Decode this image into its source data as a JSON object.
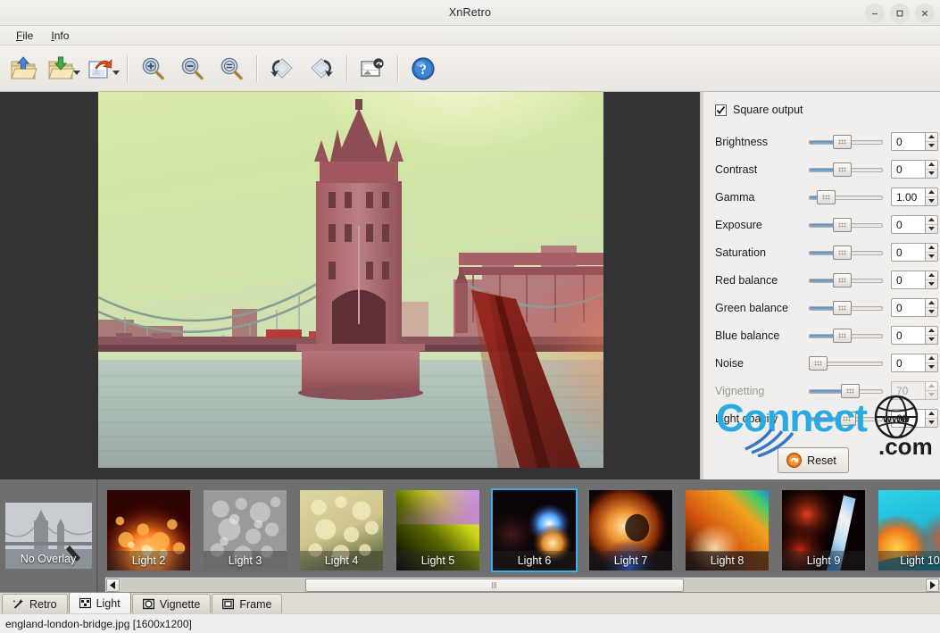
{
  "window": {
    "title": "XnRetro",
    "minimize_label": "Minimize",
    "maximize_label": "Maximize",
    "close_label": "Close"
  },
  "menu": {
    "items": [
      {
        "label": "File",
        "mnemonic": "F"
      },
      {
        "label": "Info",
        "mnemonic": "I"
      }
    ]
  },
  "toolbar": {
    "buttons": [
      {
        "name": "open-image-button",
        "tooltip": "Open image"
      },
      {
        "name": "save-image-button",
        "tooltip": "Save image"
      },
      {
        "name": "share-image-button",
        "tooltip": "Share image"
      },
      {
        "name": "zoom-in-button",
        "tooltip": "Zoom in"
      },
      {
        "name": "zoom-out-button",
        "tooltip": "Zoom out"
      },
      {
        "name": "zoom-fit-button",
        "tooltip": "Fit to window"
      },
      {
        "name": "rotate-left-button",
        "tooltip": "Rotate left"
      },
      {
        "name": "rotate-right-button",
        "tooltip": "Rotate right"
      },
      {
        "name": "reload-image-button",
        "tooltip": "Reload image"
      },
      {
        "name": "help-button",
        "tooltip": "Help"
      }
    ]
  },
  "panel": {
    "square_output": {
      "label": "Square output",
      "checked": true
    },
    "sliders": [
      {
        "label": "Brightness",
        "value": "0",
        "fill_pct": 43,
        "thumb_pct": 43,
        "enabled": true
      },
      {
        "label": "Contrast",
        "value": "0",
        "fill_pct": 43,
        "thumb_pct": 43,
        "enabled": true
      },
      {
        "label": "Gamma",
        "value": "1.00",
        "fill_pct": 14,
        "thumb_pct": 14,
        "enabled": true
      },
      {
        "label": "Exposure",
        "value": "0",
        "fill_pct": 43,
        "thumb_pct": 43,
        "enabled": true
      },
      {
        "label": "Saturation",
        "value": "0",
        "fill_pct": 43,
        "thumb_pct": 43,
        "enabled": true
      },
      {
        "label": "Red balance",
        "value": "0",
        "fill_pct": 43,
        "thumb_pct": 43,
        "enabled": true
      },
      {
        "label": "Green balance",
        "value": "0",
        "fill_pct": 43,
        "thumb_pct": 43,
        "enabled": true
      },
      {
        "label": "Blue balance",
        "value": "0",
        "fill_pct": 43,
        "thumb_pct": 43,
        "enabled": true
      },
      {
        "label": "Noise",
        "value": "0",
        "fill_pct": 0,
        "thumb_pct": 0,
        "enabled": true
      },
      {
        "label": "Vignetting",
        "value": "70",
        "fill_pct": 58,
        "thumb_pct": 58,
        "enabled": false
      },
      {
        "label": "Light opacity",
        "value": "60",
        "fill_pct": 52,
        "thumb_pct": 52,
        "enabled": true
      }
    ],
    "reset": {
      "label": "Reset"
    }
  },
  "watermark": {
    "word": "Connect",
    "globe_text": "www",
    "tld": ".com",
    "color": "#29ABE2"
  },
  "overlays": {
    "no_overlay_label": "No Overlay",
    "items": [
      {
        "label": "Light 2",
        "selected": false
      },
      {
        "label": "Light 3",
        "selected": false
      },
      {
        "label": "Light 4",
        "selected": false
      },
      {
        "label": "Light 5",
        "selected": false
      },
      {
        "label": "Light 6",
        "selected": true
      },
      {
        "label": "Light 7",
        "selected": false
      },
      {
        "label": "Light 8",
        "selected": false
      },
      {
        "label": "Light 9",
        "selected": false
      },
      {
        "label": "Light 10",
        "selected": false
      }
    ]
  },
  "tabs": [
    {
      "label": "Retro",
      "icon": "wand-icon",
      "active": false
    },
    {
      "label": "Light",
      "icon": "grid-icon",
      "active": true
    },
    {
      "label": "Vignette",
      "icon": "circle-icon",
      "active": false
    },
    {
      "label": "Frame",
      "icon": "square-icon",
      "active": false
    }
  ],
  "status": {
    "text": "england-london-bridge.jpg [1600x1200]"
  }
}
